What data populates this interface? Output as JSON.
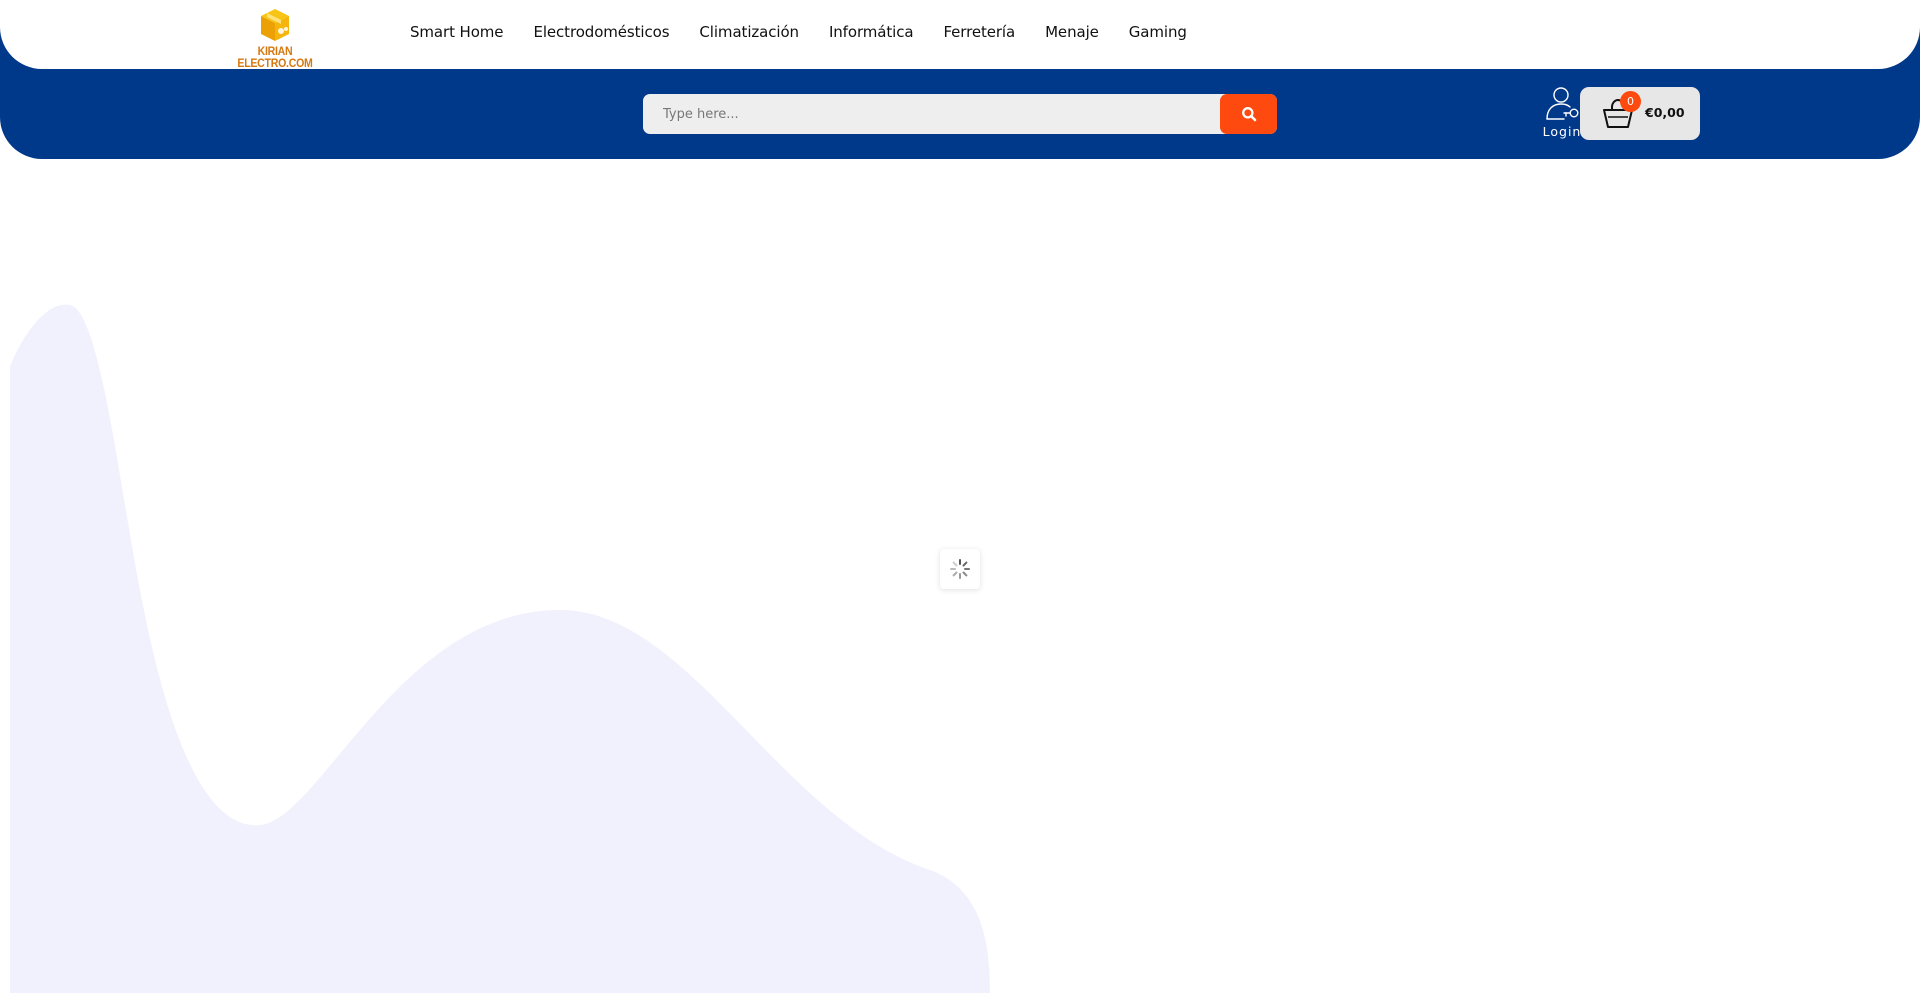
{
  "brand": {
    "logo_text": "KIRIAN ELECTRO.COM"
  },
  "nav": {
    "items": [
      {
        "label": "Smart Home"
      },
      {
        "label": "Electrodomésticos"
      },
      {
        "label": "Climatización"
      },
      {
        "label": "Informática"
      },
      {
        "label": "Ferretería"
      },
      {
        "label": "Menaje"
      },
      {
        "label": "Gaming"
      }
    ]
  },
  "search": {
    "placeholder": "Type here...",
    "button_icon": "search-icon"
  },
  "account": {
    "login_label": "Login",
    "icon": "user-key-icon"
  },
  "cart": {
    "count": "0",
    "total": "€0,00",
    "icon": "shopping-basket-icon"
  },
  "colors": {
    "header_blue": "#00388a",
    "accent_orange": "#ff4a0f",
    "logo_gold": "#f5b50a",
    "decor_wave": "#f0f1fd"
  },
  "status": {
    "loading": true,
    "spinner_icon": "spinner-icon"
  }
}
